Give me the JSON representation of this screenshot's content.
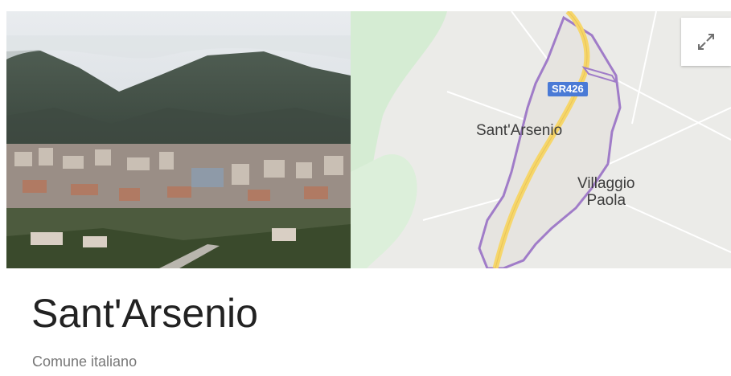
{
  "entity": {
    "title": "Sant'Arsenio",
    "subtitle": "Comune italiano"
  },
  "map": {
    "labels": {
      "town": "Sant'Arsenio",
      "village_line1": "Villaggio",
      "village_line2": "Paola",
      "road": "SR426"
    },
    "colors": {
      "land": "#ebebe8",
      "park": "#d5ecd3",
      "boundary": "#a07cc8",
      "road": "#f6d66a",
      "shield": "#4a7ad6"
    }
  },
  "icons": {
    "expand": "expand-icon"
  }
}
